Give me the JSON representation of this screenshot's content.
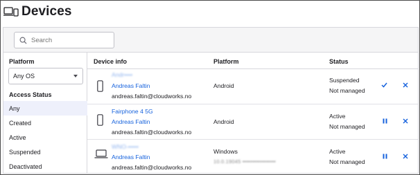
{
  "header": {
    "title": "Devices",
    "icon": "devices-icon"
  },
  "search": {
    "placeholder": "Search"
  },
  "sidebar": {
    "platform_label": "Platform",
    "platform_select": "Any OS",
    "access_status_label": "Access Status",
    "statuses": [
      "Any",
      "Created",
      "Active",
      "Suspended",
      "Deactivated"
    ],
    "selected_status": "Any"
  },
  "table": {
    "columns": [
      "Device info",
      "Platform",
      "Status"
    ],
    "rows": [
      {
        "device_icon": "phone-icon",
        "device_name": "Andr••••",
        "user": "Andreas Faltin",
        "email": "andreas.faltin@cloudworks.no",
        "platform": "Android",
        "platform_detail": "",
        "status": "Suspended",
        "management": "Not managed",
        "actions": [
          "unsuspend-icon",
          "deactivate-icon"
        ]
      },
      {
        "device_icon": "phone-icon",
        "device_name": "Fairphone 4 5G",
        "user": "Andreas Faltin",
        "email": "andreas.faltin@cloudworks.no",
        "platform": "Android",
        "platform_detail": "",
        "status": "Active",
        "management": "Not managed",
        "actions": [
          "suspend-icon",
          "deactivate-icon"
        ]
      },
      {
        "device_icon": "laptop-icon",
        "device_name": "WNO-•••••",
        "user": "Andreas Faltin",
        "email": "andreas.faltin@cloudworks.no",
        "platform": "Windows",
        "platform_detail": "10.0.19045 •••••••••••••••••",
        "status": "Active",
        "management": "Not managed",
        "actions": [
          "suspend-icon",
          "deactivate-icon"
        ]
      }
    ]
  },
  "colors": {
    "link": "#1662dd",
    "selected_bg": "#eef0fb",
    "border": "#d7d7dc"
  }
}
